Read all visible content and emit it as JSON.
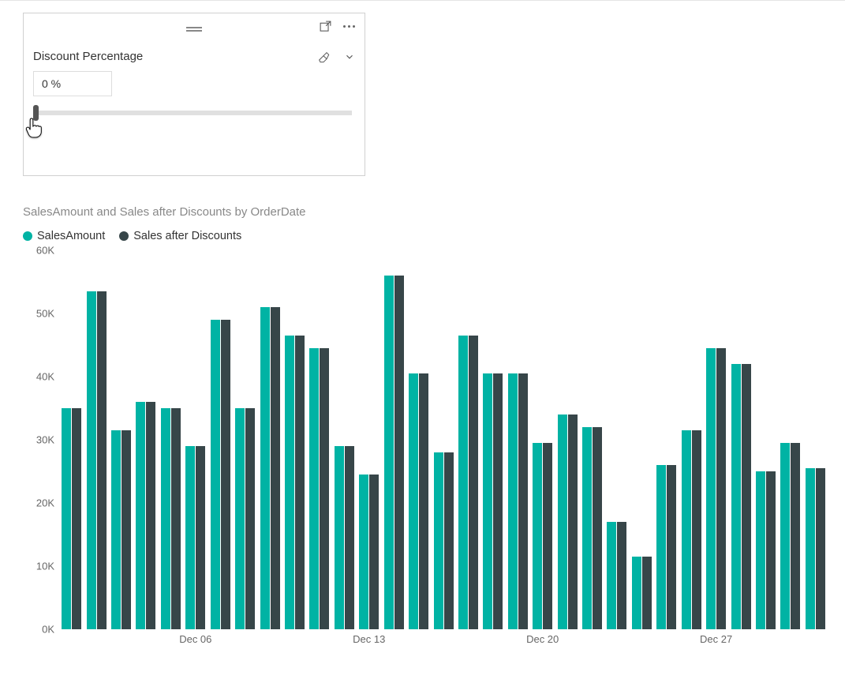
{
  "slicer": {
    "title": "Discount Percentage",
    "value_text": "0 %",
    "slider_position_pct": 0
  },
  "chart_data": {
    "type": "bar",
    "title": "SalesAmount and Sales after Discounts by OrderDate",
    "ylabel": "",
    "xlabel": "",
    "ylim": [
      0,
      60000
    ],
    "y_ticks": [
      "0K",
      "10K",
      "20K",
      "30K",
      "40K",
      "50K",
      "60K"
    ],
    "x_tick_labels": [
      "Dec 06",
      "Dec 13",
      "Dec 20",
      "Dec 27"
    ],
    "x_tick_positions": [
      5,
      12,
      19,
      26
    ],
    "legend": [
      {
        "name": "SalesAmount",
        "color": "#00b3a4"
      },
      {
        "name": "Sales after Discounts",
        "color": "#374649"
      }
    ],
    "categories": [
      "Dec 01",
      "Dec 02",
      "Dec 03",
      "Dec 04",
      "Dec 05",
      "Dec 06",
      "Dec 07",
      "Dec 08",
      "Dec 09",
      "Dec 10",
      "Dec 11",
      "Dec 12",
      "Dec 13",
      "Dec 14",
      "Dec 15",
      "Dec 16",
      "Dec 17",
      "Dec 18",
      "Dec 19",
      "Dec 20",
      "Dec 21",
      "Dec 22",
      "Dec 23",
      "Dec 24",
      "Dec 25",
      "Dec 26",
      "Dec 27",
      "Dec 28",
      "Dec 29",
      "Dec 30",
      "Dec 31"
    ],
    "series": [
      {
        "name": "SalesAmount",
        "values": [
          35000,
          53500,
          31500,
          36000,
          35000,
          29000,
          49000,
          35000,
          51000,
          46500,
          44500,
          29000,
          24500,
          56000,
          40500,
          28000,
          46500,
          40500,
          40500,
          29500,
          34000,
          32000,
          17000,
          11500,
          26000,
          31500,
          44500,
          42000,
          25000,
          29500,
          25500
        ]
      },
      {
        "name": "Sales after Discounts",
        "values": [
          35000,
          53500,
          31500,
          36000,
          35000,
          29000,
          49000,
          35000,
          51000,
          46500,
          44500,
          29000,
          24500,
          56000,
          40500,
          28000,
          46500,
          40500,
          40500,
          29500,
          34000,
          32000,
          17000,
          11500,
          26000,
          31500,
          44500,
          42000,
          25000,
          29500,
          25500
        ]
      }
    ]
  }
}
